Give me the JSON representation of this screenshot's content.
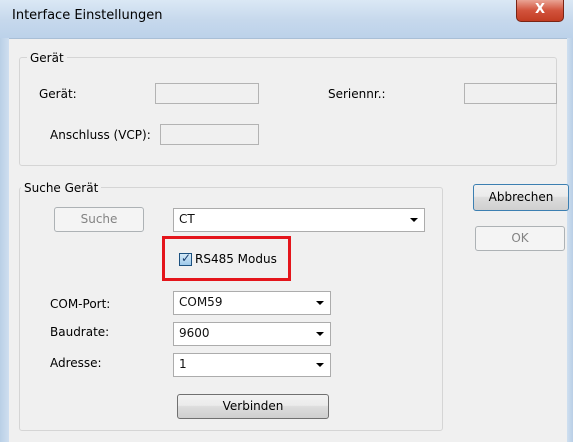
{
  "window": {
    "title": "Interface Einstellungen",
    "close_glyph": "X"
  },
  "geraet_group": {
    "legend": "Gerät",
    "geraet_label": "Gerät:",
    "geraet_value": "",
    "seriennr_label": "Seriennr.:",
    "seriennr_value": "",
    "anschluss_label": "Anschluss (VCP):",
    "anschluss_value": ""
  },
  "suche_group": {
    "legend": "Suche Gerät",
    "suche_button": "Suche",
    "device_type": {
      "value": "CT"
    },
    "rs485": {
      "label": "RS485 Modus",
      "checked": true,
      "check_glyph": "✓"
    },
    "com_port": {
      "label": "COM-Port:",
      "value": "COM59"
    },
    "baudrate": {
      "label": "Baudrate:",
      "value": "9600"
    },
    "adresse": {
      "label": "Adresse:",
      "value": "1"
    },
    "verbinden_button": "Verbinden"
  },
  "buttons": {
    "abbrechen": "Abbrechen",
    "ok": "OK"
  },
  "colors": {
    "highlight": "#e4151b",
    "client_bg": "#f0f0f0"
  }
}
